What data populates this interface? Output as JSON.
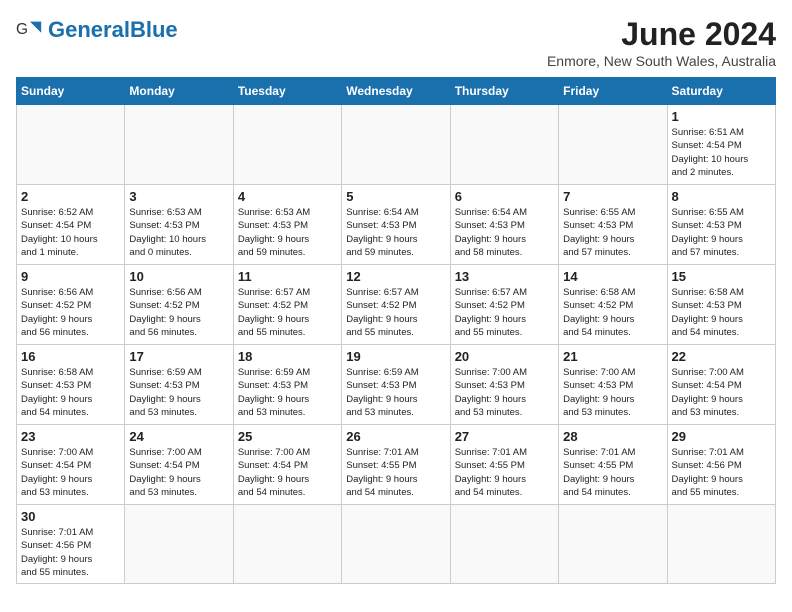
{
  "header": {
    "logo_general": "General",
    "logo_blue": "Blue",
    "title": "June 2024",
    "subtitle": "Enmore, New South Wales, Australia"
  },
  "days": [
    "Sunday",
    "Monday",
    "Tuesday",
    "Wednesday",
    "Thursday",
    "Friday",
    "Saturday"
  ],
  "weeks": [
    [
      {
        "date": "",
        "info": ""
      },
      {
        "date": "",
        "info": ""
      },
      {
        "date": "",
        "info": ""
      },
      {
        "date": "",
        "info": ""
      },
      {
        "date": "",
        "info": ""
      },
      {
        "date": "",
        "info": ""
      },
      {
        "date": "1",
        "info": "Sunrise: 6:51 AM\nSunset: 4:54 PM\nDaylight: 10 hours\nand 2 minutes."
      }
    ],
    [
      {
        "date": "2",
        "info": "Sunrise: 6:52 AM\nSunset: 4:54 PM\nDaylight: 10 hours\nand 1 minute."
      },
      {
        "date": "3",
        "info": "Sunrise: 6:53 AM\nSunset: 4:53 PM\nDaylight: 10 hours\nand 0 minutes."
      },
      {
        "date": "4",
        "info": "Sunrise: 6:53 AM\nSunset: 4:53 PM\nDaylight: 9 hours\nand 59 minutes."
      },
      {
        "date": "5",
        "info": "Sunrise: 6:54 AM\nSunset: 4:53 PM\nDaylight: 9 hours\nand 59 minutes."
      },
      {
        "date": "6",
        "info": "Sunrise: 6:54 AM\nSunset: 4:53 PM\nDaylight: 9 hours\nand 58 minutes."
      },
      {
        "date": "7",
        "info": "Sunrise: 6:55 AM\nSunset: 4:53 PM\nDaylight: 9 hours\nand 57 minutes."
      },
      {
        "date": "8",
        "info": "Sunrise: 6:55 AM\nSunset: 4:53 PM\nDaylight: 9 hours\nand 57 minutes."
      }
    ],
    [
      {
        "date": "9",
        "info": "Sunrise: 6:56 AM\nSunset: 4:52 PM\nDaylight: 9 hours\nand 56 minutes."
      },
      {
        "date": "10",
        "info": "Sunrise: 6:56 AM\nSunset: 4:52 PM\nDaylight: 9 hours\nand 56 minutes."
      },
      {
        "date": "11",
        "info": "Sunrise: 6:57 AM\nSunset: 4:52 PM\nDaylight: 9 hours\nand 55 minutes."
      },
      {
        "date": "12",
        "info": "Sunrise: 6:57 AM\nSunset: 4:52 PM\nDaylight: 9 hours\nand 55 minutes."
      },
      {
        "date": "13",
        "info": "Sunrise: 6:57 AM\nSunset: 4:52 PM\nDaylight: 9 hours\nand 55 minutes."
      },
      {
        "date": "14",
        "info": "Sunrise: 6:58 AM\nSunset: 4:52 PM\nDaylight: 9 hours\nand 54 minutes."
      },
      {
        "date": "15",
        "info": "Sunrise: 6:58 AM\nSunset: 4:53 PM\nDaylight: 9 hours\nand 54 minutes."
      }
    ],
    [
      {
        "date": "16",
        "info": "Sunrise: 6:58 AM\nSunset: 4:53 PM\nDaylight: 9 hours\nand 54 minutes."
      },
      {
        "date": "17",
        "info": "Sunrise: 6:59 AM\nSunset: 4:53 PM\nDaylight: 9 hours\nand 53 minutes."
      },
      {
        "date": "18",
        "info": "Sunrise: 6:59 AM\nSunset: 4:53 PM\nDaylight: 9 hours\nand 53 minutes."
      },
      {
        "date": "19",
        "info": "Sunrise: 6:59 AM\nSunset: 4:53 PM\nDaylight: 9 hours\nand 53 minutes."
      },
      {
        "date": "20",
        "info": "Sunrise: 7:00 AM\nSunset: 4:53 PM\nDaylight: 9 hours\nand 53 minutes."
      },
      {
        "date": "21",
        "info": "Sunrise: 7:00 AM\nSunset: 4:53 PM\nDaylight: 9 hours\nand 53 minutes."
      },
      {
        "date": "22",
        "info": "Sunrise: 7:00 AM\nSunset: 4:54 PM\nDaylight: 9 hours\nand 53 minutes."
      }
    ],
    [
      {
        "date": "23",
        "info": "Sunrise: 7:00 AM\nSunset: 4:54 PM\nDaylight: 9 hours\nand 53 minutes."
      },
      {
        "date": "24",
        "info": "Sunrise: 7:00 AM\nSunset: 4:54 PM\nDaylight: 9 hours\nand 53 minutes."
      },
      {
        "date": "25",
        "info": "Sunrise: 7:00 AM\nSunset: 4:54 PM\nDaylight: 9 hours\nand 54 minutes."
      },
      {
        "date": "26",
        "info": "Sunrise: 7:01 AM\nSunset: 4:55 PM\nDaylight: 9 hours\nand 54 minutes."
      },
      {
        "date": "27",
        "info": "Sunrise: 7:01 AM\nSunset: 4:55 PM\nDaylight: 9 hours\nand 54 minutes."
      },
      {
        "date": "28",
        "info": "Sunrise: 7:01 AM\nSunset: 4:55 PM\nDaylight: 9 hours\nand 54 minutes."
      },
      {
        "date": "29",
        "info": "Sunrise: 7:01 AM\nSunset: 4:56 PM\nDaylight: 9 hours\nand 55 minutes."
      }
    ],
    [
      {
        "date": "30",
        "info": "Sunrise: 7:01 AM\nSunset: 4:56 PM\nDaylight: 9 hours\nand 55 minutes."
      },
      {
        "date": "",
        "info": ""
      },
      {
        "date": "",
        "info": ""
      },
      {
        "date": "",
        "info": ""
      },
      {
        "date": "",
        "info": ""
      },
      {
        "date": "",
        "info": ""
      },
      {
        "date": "",
        "info": ""
      }
    ]
  ]
}
